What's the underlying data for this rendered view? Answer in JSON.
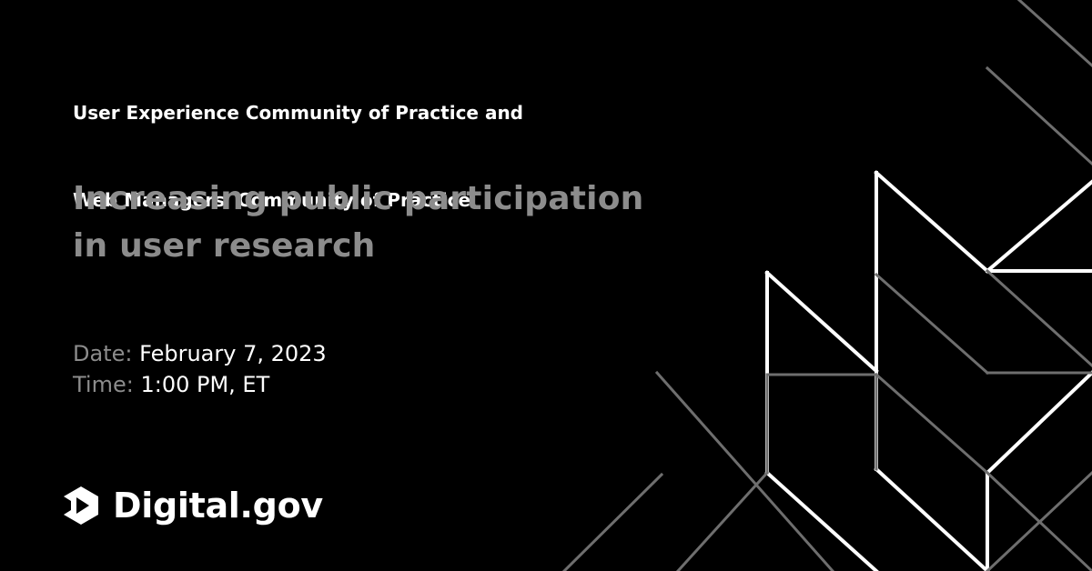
{
  "header": {
    "community_line1": "User Experience Community of Practice and",
    "community_line2": "Web Managers  Community of Practice"
  },
  "headline": {
    "line1": "Increasing public participation",
    "line2": "in user research"
  },
  "event": {
    "date_label": "Date:",
    "date_value": "February 7, 2023",
    "time_label": "Time:",
    "time_value": "1:00 PM, ET"
  },
  "brand": {
    "name": "Digital.gov",
    "icon": "digital-gov-logo-icon"
  },
  "colors": {
    "background": "#000000",
    "primary_text": "#ffffff",
    "muted_text": "#8c8c8c",
    "line_white": "#ffffff",
    "line_gray": "#6e6e6e"
  }
}
